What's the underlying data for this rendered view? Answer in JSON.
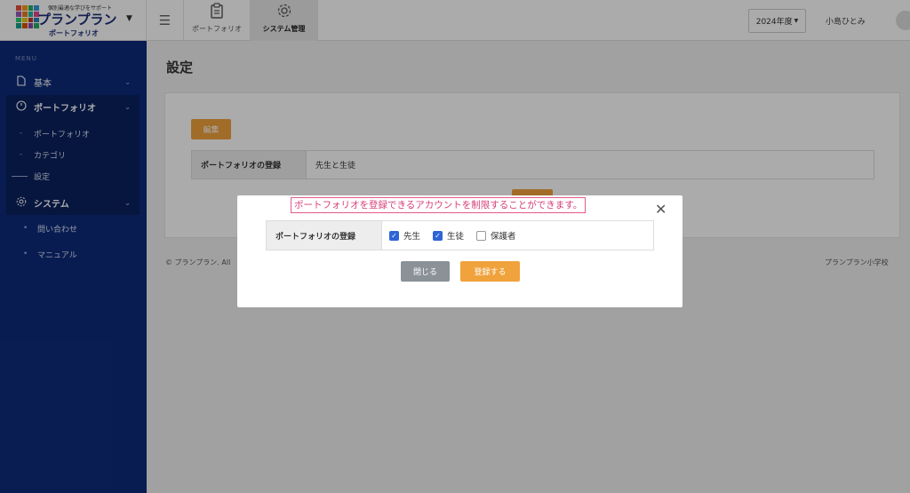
{
  "header": {
    "logo_tagline": "個別最適な学びをサポート",
    "logo_name": "プランプラン",
    "logo_sub": "ポートフォリオ",
    "tabs": [
      {
        "label": "ポートフォリオ",
        "icon": "clipboard-icon"
      },
      {
        "label": "システム管理",
        "icon": "gear-icon"
      }
    ],
    "year_label": "2024年度",
    "user_name": "小島ひとみ"
  },
  "sidebar": {
    "menu_label": "MENU",
    "items": [
      {
        "label": "基本"
      },
      {
        "label": "ポートフォリオ"
      },
      {
        "label": "ポートフォリオ"
      },
      {
        "label": "カテゴリ"
      },
      {
        "label": "設定"
      },
      {
        "label": "システム"
      },
      {
        "label": "問い合わせ"
      },
      {
        "label": "マニュアル"
      }
    ]
  },
  "main": {
    "page_title": "設定",
    "edit_label": "編集",
    "row_header": "ポートフォリオの登録",
    "row_value": "先生と生徒",
    "footer_left": "© プランプラン. All",
    "footer_right": "プランプラン小学校"
  },
  "modal": {
    "notice": "ポートフォリオを登録できるアカウントを制限することができます。",
    "row_header": "ポートフォリオの登録",
    "options": [
      {
        "label": "先生",
        "checked": true
      },
      {
        "label": "生徒",
        "checked": true
      },
      {
        "label": "保護者",
        "checked": false
      }
    ],
    "close_label": "閉じる",
    "submit_label": "登録する"
  },
  "colors": {
    "sidebar": "#0d2b7a",
    "accent": "#f0a23c",
    "notice": "#d63f77",
    "checkbox": "#2f64d6"
  }
}
